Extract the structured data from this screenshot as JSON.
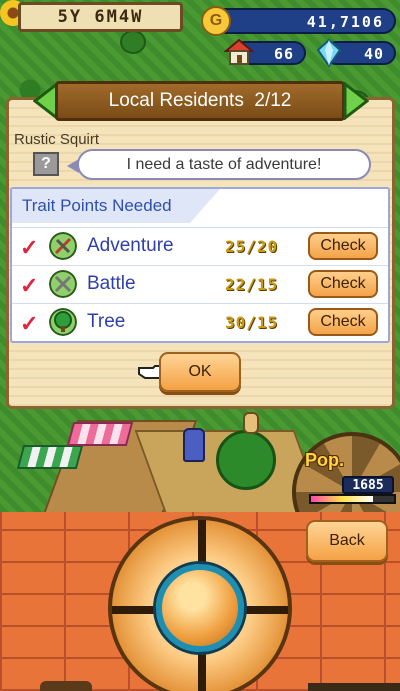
{
  "hud": {
    "date": "5Y 6M4W",
    "money": "41,7106",
    "coin_symbol": "G",
    "houses": "66",
    "crystals": "40"
  },
  "dialog": {
    "title": "Local Residents",
    "page": "2/12",
    "resident_name": "Rustic Squirt",
    "portrait_placeholder": "?",
    "speech": "I need a taste of adventure!",
    "traits_header": "Trait Points Needed",
    "traits": [
      {
        "name": "Adventure",
        "points": "25/20",
        "met": true,
        "button": "Check",
        "icon": "adventure-icon",
        "color": "#c0392b"
      },
      {
        "name": "Battle",
        "points": "22/15",
        "met": true,
        "button": "Check",
        "icon": "battle-icon",
        "color": "#7f8c8d"
      },
      {
        "name": "Tree",
        "points": "30/15",
        "met": true,
        "button": "Check",
        "icon": "tree-icon",
        "color": "#2e9e3a"
      }
    ],
    "ok_label": "OK"
  },
  "population": {
    "label": "Pop.",
    "value": "1685",
    "fill_fraction": 0.75
  },
  "controls": {
    "back_label": "Back"
  },
  "colors": {
    "accent_blue": "#2f3fa8",
    "button_orange": "#f4a349",
    "check_red": "#e0243c"
  }
}
